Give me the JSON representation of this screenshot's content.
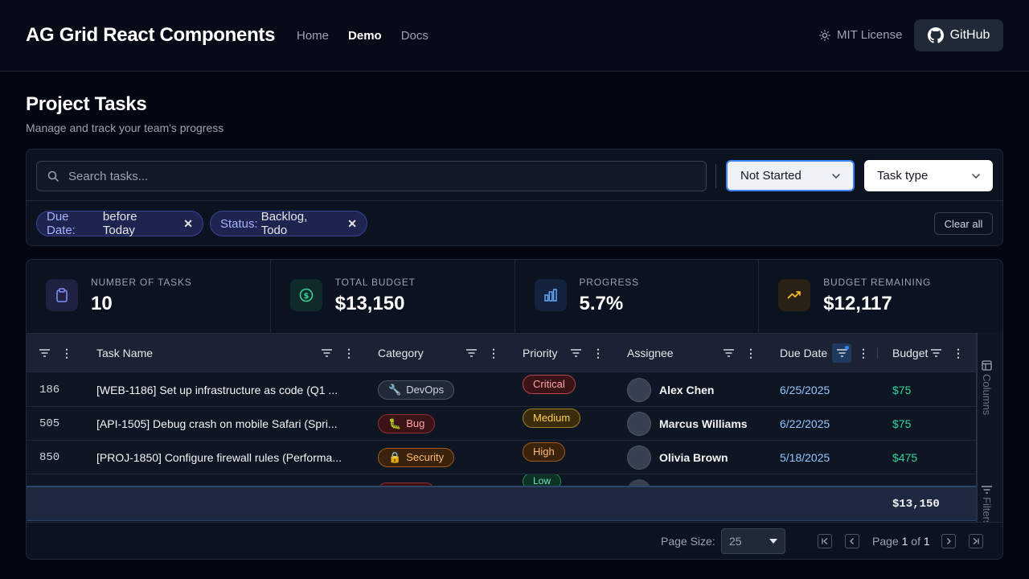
{
  "header": {
    "brand": "AG Grid React Components",
    "nav": [
      "Home",
      "Demo",
      "Docs"
    ],
    "license": "MIT License",
    "github": "GitHub"
  },
  "page": {
    "title": "Project Tasks",
    "subtitle": "Manage and track your team's progress"
  },
  "filters": {
    "search_placeholder": "Search tasks...",
    "status_select": "Not Started",
    "type_select": "Task type",
    "chips": [
      {
        "key": "Due Date:",
        "value": "before Today"
      },
      {
        "key": "Status:",
        "value": "Backlog, Todo"
      }
    ],
    "clear_all": "Clear all"
  },
  "stats": [
    {
      "label": "NUMBER OF TASKS",
      "value": "10",
      "icon": "clipboard-icon",
      "color": "#818cf8"
    },
    {
      "label": "TOTAL BUDGET",
      "value": "$13,150",
      "icon": "dollar-icon",
      "color": "#34d399"
    },
    {
      "label": "PROGRESS",
      "value": "5.7%",
      "icon": "bar-chart-icon",
      "color": "#60a5fa"
    },
    {
      "label": "BUDGET REMAINING",
      "value": "$12,117",
      "icon": "trending-up-icon",
      "color": "#fbbf24"
    }
  ],
  "grid": {
    "columns": [
      "Task Name",
      "Category",
      "Priority",
      "Assignee",
      "Due Date",
      "Budget"
    ],
    "rows": [
      {
        "id": "186",
        "task": "[WEB-1186] Set up infrastructure as code (Q1 ...",
        "category": "DevOps",
        "category_emoji": "🔧",
        "priority": "Critical",
        "assignee": "Alex Chen",
        "due": "6/25/2025",
        "budget": "$75"
      },
      {
        "id": "505",
        "task": "[API-1505] Debug crash on mobile Safari (Spri...",
        "category": "Bug",
        "category_emoji": "🐛",
        "priority": "Medium",
        "assignee": "Marcus Williams",
        "due": "6/22/2025",
        "budget": "$75"
      },
      {
        "id": "850",
        "task": "[PROJ-1850] Configure firewall rules (Performa...",
        "category": "Security",
        "category_emoji": "🔒",
        "priority": "High",
        "assignee": "Olivia Brown",
        "due": "5/18/2025",
        "budget": "$475"
      }
    ],
    "partial_priority": "Low",
    "total_budget": "$13,150",
    "side_tabs": [
      "Columns",
      "Filters"
    ]
  },
  "pager": {
    "page_size_label": "Page Size:",
    "page_size": "25",
    "page_text_prefix": "Page",
    "current": "1",
    "of": "of",
    "total": "1"
  }
}
